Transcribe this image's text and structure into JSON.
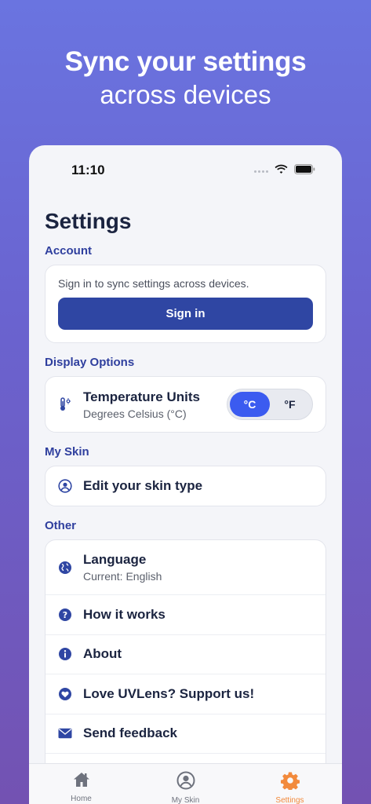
{
  "promo": {
    "line1": "Sync your settings",
    "line2": "across devices"
  },
  "status_bar": {
    "time": "11:10"
  },
  "page": {
    "title": "Settings"
  },
  "account": {
    "label": "Account",
    "text": "Sign in to sync settings across devices.",
    "signin_label": "Sign in"
  },
  "display": {
    "label": "Display Options",
    "temp_title": "Temperature Units",
    "temp_sub": "Degrees Celsius (°C)",
    "options": [
      "°C",
      "°F"
    ],
    "selected": "°C"
  },
  "my_skin": {
    "label": "My Skin",
    "edit_label": "Edit your skin type"
  },
  "other": {
    "label": "Other",
    "language_title": "Language",
    "language_sub": "Current: English",
    "how_it_works": "How it works",
    "about": "About",
    "support": "Love UVLens? Support us!",
    "feedback": "Send feedback"
  },
  "tabbar": {
    "home": "Home",
    "my_skin": "My Skin",
    "settings": "Settings",
    "active": "Settings"
  },
  "colors": {
    "accent": "#2f46a3",
    "toggle_active": "#3b5bf0",
    "tab_active": "#f28a3c",
    "section_label": "#2f3f9e"
  }
}
